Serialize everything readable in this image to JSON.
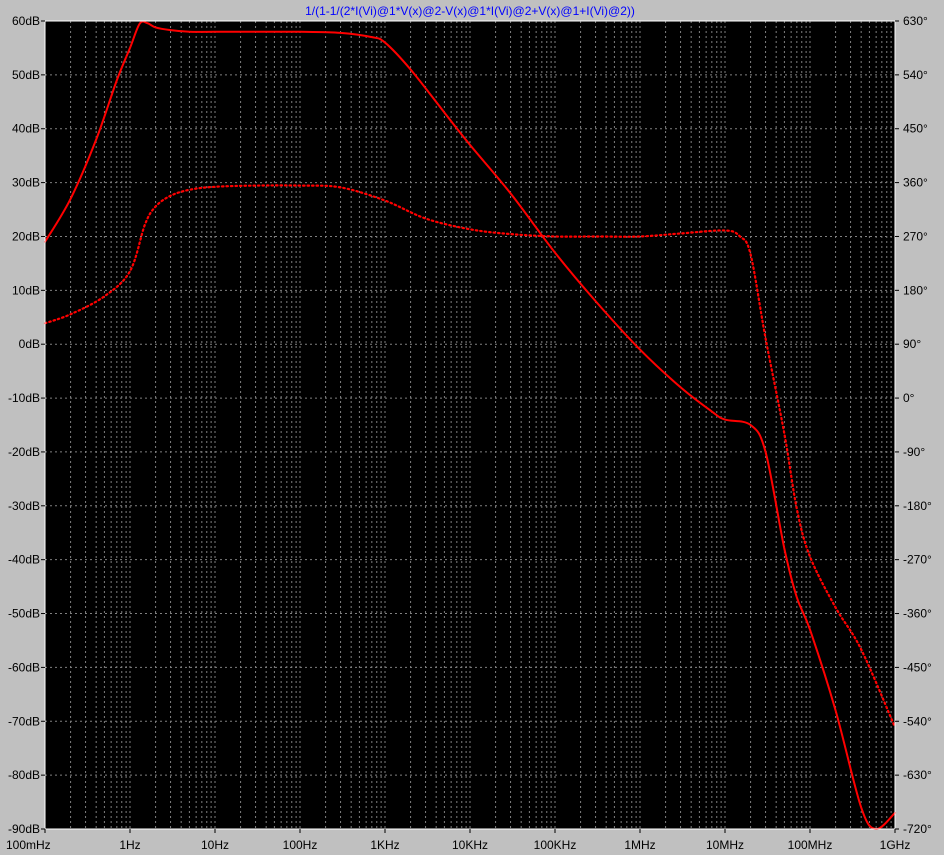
{
  "chart_data": {
    "type": "line",
    "title": "1/(1-1/(2*I(Vi)@1*V(x)@2-V(x)@1*I(Vi)@2+V(x)@1+I(Vi)@2))",
    "x_scale": "log",
    "xlim_hz": [
      0.1,
      1000000000
    ],
    "x_ticks": [
      {
        "hz": 0.1,
        "label": "100mHz"
      },
      {
        "hz": 1,
        "label": "1Hz"
      },
      {
        "hz": 10,
        "label": "10Hz"
      },
      {
        "hz": 100,
        "label": "100Hz"
      },
      {
        "hz": 1000,
        "label": "1KHz"
      },
      {
        "hz": 10000,
        "label": "10KHz"
      },
      {
        "hz": 100000,
        "label": "100KHz"
      },
      {
        "hz": 1000000,
        "label": "1MHz"
      },
      {
        "hz": 10000000,
        "label": "10MHz"
      },
      {
        "hz": 100000000,
        "label": "100MHz"
      },
      {
        "hz": 1000000000,
        "label": "1GHz"
      }
    ],
    "y_left": {
      "unit": "dB",
      "lim": [
        -90,
        60
      ],
      "ticks": [
        {
          "v": 60,
          "label": "60dB"
        },
        {
          "v": 50,
          "label": "50dB"
        },
        {
          "v": 40,
          "label": "40dB"
        },
        {
          "v": 30,
          "label": "30dB"
        },
        {
          "v": 20,
          "label": "20dB"
        },
        {
          "v": 10,
          "label": "10dB"
        },
        {
          "v": 0,
          "label": "0dB"
        },
        {
          "v": -10,
          "label": "-10dB"
        },
        {
          "v": -20,
          "label": "-20dB"
        },
        {
          "v": -30,
          "label": "-30dB"
        },
        {
          "v": -40,
          "label": "-40dB"
        },
        {
          "v": -50,
          "label": "-50dB"
        },
        {
          "v": -60,
          "label": "-60dB"
        },
        {
          "v": -70,
          "label": "-70dB"
        },
        {
          "v": -80,
          "label": "-80dB"
        },
        {
          "v": -90,
          "label": "-90dB"
        }
      ]
    },
    "y_right": {
      "unit": "°",
      "lim": [
        -720,
        630
      ],
      "ticks": [
        {
          "v": 630,
          "label": "630°"
        },
        {
          "v": 540,
          "label": "540°"
        },
        {
          "v": 450,
          "label": "450°"
        },
        {
          "v": 360,
          "label": "360°"
        },
        {
          "v": 270,
          "label": "270°"
        },
        {
          "v": 180,
          "label": "180°"
        },
        {
          "v": 90,
          "label": "90°"
        },
        {
          "v": 0,
          "label": "0°"
        },
        {
          "v": -90,
          "label": "-90°"
        },
        {
          "v": -180,
          "label": "-180°"
        },
        {
          "v": -270,
          "label": "-270°"
        },
        {
          "v": -360,
          "label": "-360°"
        },
        {
          "v": -450,
          "label": "-450°"
        },
        {
          "v": -540,
          "label": "-540°"
        },
        {
          "v": -630,
          "label": "-630°"
        },
        {
          "v": -720,
          "label": "-720°"
        }
      ]
    },
    "grid": true,
    "colors": {
      "background": "#000000",
      "frame": "#c0c0c0",
      "grid": "#808080",
      "trace": "#ff0000",
      "title": "#0000ff",
      "labels": "#000000"
    },
    "series": [
      {
        "axis": "left",
        "style": "solid",
        "x": [
          0.1,
          0.2,
          0.4,
          0.7,
          1,
          1.3,
          1.6,
          2,
          3,
          5,
          10,
          30,
          100,
          300,
          700,
          1000,
          2000,
          5000,
          10000,
          30000,
          100000,
          300000,
          1000000,
          3000000,
          7000000,
          10000000,
          20000000,
          30000000,
          50000000,
          70000000,
          100000000,
          200000000,
          400000000,
          600000000,
          1000000000
        ],
        "y": [
          19,
          27,
          38,
          49,
          55,
          59.5,
          59.6,
          58.8,
          58.3,
          58,
          58,
          58,
          58,
          57.8,
          57,
          56,
          51,
          43,
          37,
          28,
          17,
          8,
          -1,
          -8,
          -12.5,
          -14,
          -15,
          -20,
          -38,
          -47,
          -53,
          -68,
          -86,
          -90,
          -87
        ]
      },
      {
        "axis": "right",
        "style": "dotted",
        "x": [
          0.1,
          0.2,
          0.5,
          1,
          1.5,
          2,
          3,
          5,
          10,
          30,
          100,
          300,
          1000,
          3000,
          10000,
          30000,
          100000,
          300000,
          1000000,
          3000000,
          10000000,
          15000000,
          20000000,
          30000000,
          50000000,
          70000000,
          100000000,
          200000000,
          400000000,
          1000000000
        ],
        "y": [
          125,
          140,
          170,
          212,
          290,
          320,
          338,
          348,
          353,
          355,
          355,
          352,
          330,
          300,
          282,
          274,
          270,
          270,
          270,
          275,
          280,
          270,
          240,
          100,
          -60,
          -185,
          -265,
          -350,
          -420,
          -550
        ]
      }
    ]
  }
}
